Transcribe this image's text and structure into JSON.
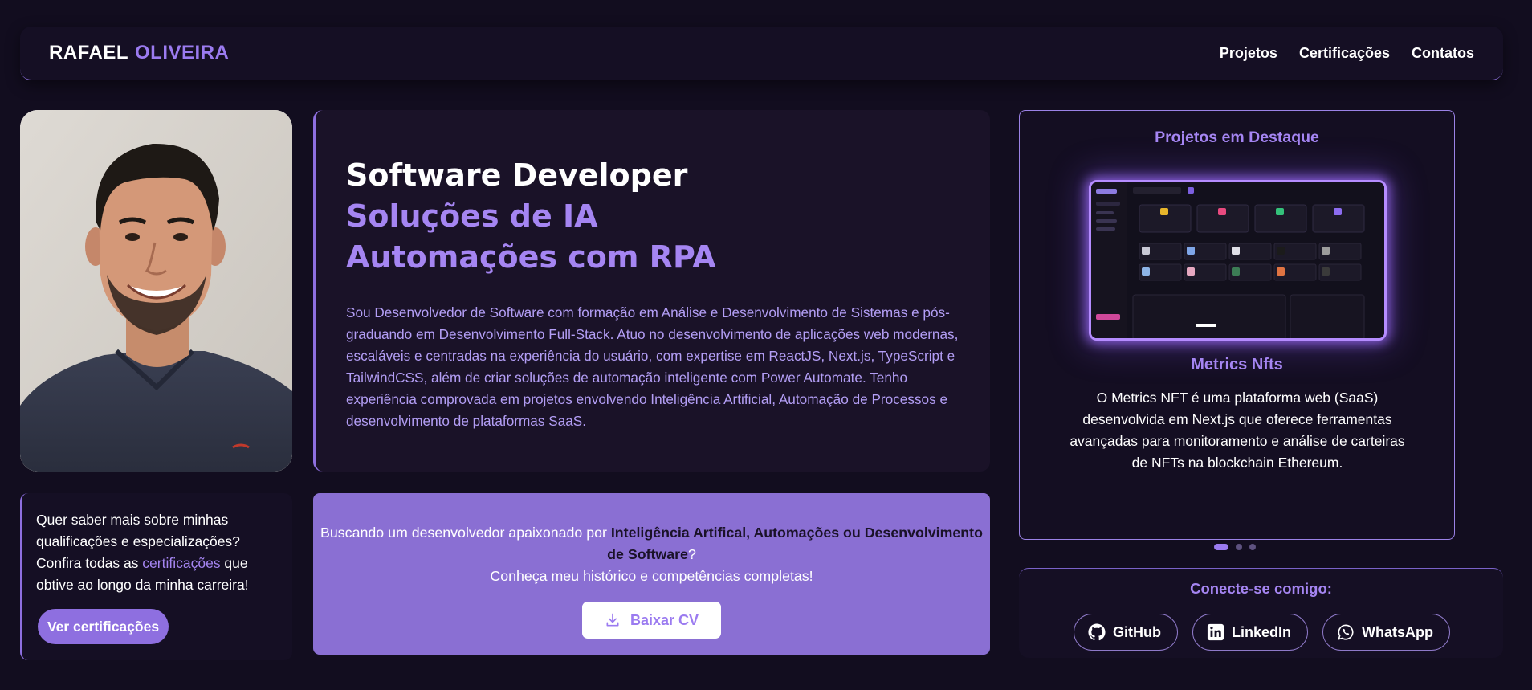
{
  "header": {
    "logo_first": "RAFAEL",
    "logo_last": "OLIVEIRA",
    "nav": [
      "Projetos",
      "Certificações",
      "Contatos"
    ]
  },
  "hero": {
    "line1": "Software Developer",
    "line2": "Soluções de IA",
    "line3": "Automações com RPA",
    "bio": "Sou Desenvolvedor de Software com formação em Análise e Desenvolvimento de Sistemas e pós-graduando em Desenvolvimento Full-Stack. Atuo no desenvolvimento de aplicações web modernas, escaláveis e centradas na experiência do usuário, com expertise em ReactJS, Next.js, TypeScript e TailwindCSS, além de criar soluções de automação inteligente com Power Automate. Tenho experiência comprovada em projetos envolvendo Inteligência Artificial, Automação de Processos e desenvolvimento de plataformas SaaS."
  },
  "featured": {
    "title": "Projetos em Destaque",
    "project_name": "Metrics Nfts",
    "project_description": "O Metrics NFT é uma plataforma web (SaaS) desenvolvida em Next.js que oferece ferramentas avançadas para monitoramento e análise de carteiras de NFTs na blockchain Ethereum.",
    "carousel_active_index": 0,
    "carousel_count": 3
  },
  "qualifications": {
    "text_before": "Quer saber mais sobre minhas qualificações e especializações? Confira todas as ",
    "link": "certificações",
    "text_after": " que obtive ao longo da minha carreira!",
    "button": "Ver certificações"
  },
  "cta": {
    "text_before": "Buscando um desenvolvedor apaixonado por ",
    "highlight": "Inteligência Artifical, Automações ou Desenvolvimento de Software",
    "text_after": "?",
    "line2": "Conheça meu histórico e competências completas!",
    "button": "Baixar CV"
  },
  "connect": {
    "title": "Conecte-se comigo:",
    "links": [
      {
        "label": "GitHub",
        "icon": "github-icon"
      },
      {
        "label": "LinkedIn",
        "icon": "linkedin-icon"
      },
      {
        "label": "WhatsApp",
        "icon": "whatsapp-icon"
      }
    ]
  },
  "colors": {
    "background": "#120d1f",
    "accent": "#9b7bf0",
    "cta_background": "#8a6fd3"
  }
}
